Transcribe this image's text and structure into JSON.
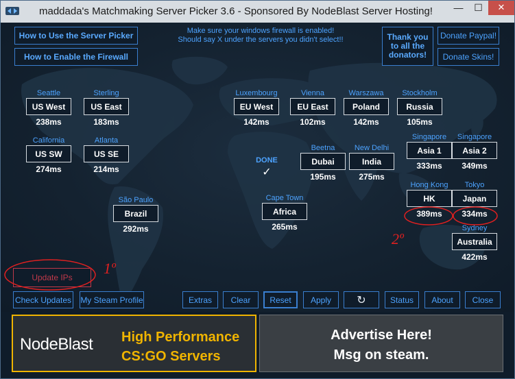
{
  "window": {
    "title": "maddada's Matchmaking Server Picker 3.6 - Sponsored By NodeBlast Server Hosting!",
    "min_glyph": "—",
    "max_glyph": "☐",
    "close_glyph": "✕"
  },
  "top_buttons": {
    "how_to_use": "How to Use the Server Picker",
    "how_to_firewall": "How to Enable the Firewall",
    "thank_donators": "Thank you to all the donators!",
    "donate_paypal": "Donate Paypal!",
    "donate_skins": "Donate Skins!"
  },
  "notice": {
    "line1": "Make sure your windows firewall is enabled!",
    "line2": "Should say X under the servers you didn't select!!"
  },
  "servers": [
    {
      "city": "Seattle",
      "label": "US West",
      "ping": "238ms"
    },
    {
      "city": "Sterling",
      "label": "US East",
      "ping": "183ms"
    },
    {
      "city": "California",
      "label": "US SW",
      "ping": "274ms"
    },
    {
      "city": "Atlanta",
      "label": "US SE",
      "ping": "214ms"
    },
    {
      "city": "São Paulo",
      "label": "Brazil",
      "ping": "292ms"
    },
    {
      "city": "Luxembourg",
      "label": "EU West",
      "ping": "142ms"
    },
    {
      "city": "Vienna",
      "label": "EU East",
      "ping": "102ms"
    },
    {
      "city": "Warszawa",
      "label": "Poland",
      "ping": "142ms"
    },
    {
      "city": "Stockholm",
      "label": "Russia",
      "ping": "105ms"
    },
    {
      "city": "Beetna",
      "label": "Dubai",
      "ping": "195ms"
    },
    {
      "city": "New Delhi",
      "label": "India",
      "ping": "275ms"
    },
    {
      "city": "Cape Town",
      "label": "Africa",
      "ping": "265ms"
    },
    {
      "city": "Singapore",
      "label": "Asia 1",
      "ping": "333ms"
    },
    {
      "city": "Singapore",
      "label": "Asia 2",
      "ping": "349ms"
    },
    {
      "city": "Hong Kong",
      "label": "HK",
      "ping": "389ms"
    },
    {
      "city": "Tokyo",
      "label": "Japan",
      "ping": "334ms"
    },
    {
      "city": "Sydney",
      "label": "Australia",
      "ping": "422ms"
    }
  ],
  "done": {
    "label": "DONE",
    "check": "✓"
  },
  "update_ips": "Update IPs",
  "bottom_buttons": {
    "check_updates": "Check Updates",
    "steam_profile": "My Steam Profile",
    "extras": "Extras",
    "clear": "Clear",
    "reset": "Reset",
    "apply": "Apply",
    "refresh_glyph": "↻",
    "status": "Status",
    "about": "About",
    "close": "Close"
  },
  "banner_left": {
    "logo": "NodeBlast",
    "tag1": "High Performance",
    "tag2": "CS:GO Servers"
  },
  "banner_right": {
    "line1": "Advertise Here!",
    "line2": "Msg on steam."
  },
  "annotations": {
    "one": "1º",
    "two": "2º"
  },
  "colors": {
    "accent": "#4da3ff",
    "annotation": "#e02020",
    "banner_gold": "#f0b400"
  }
}
